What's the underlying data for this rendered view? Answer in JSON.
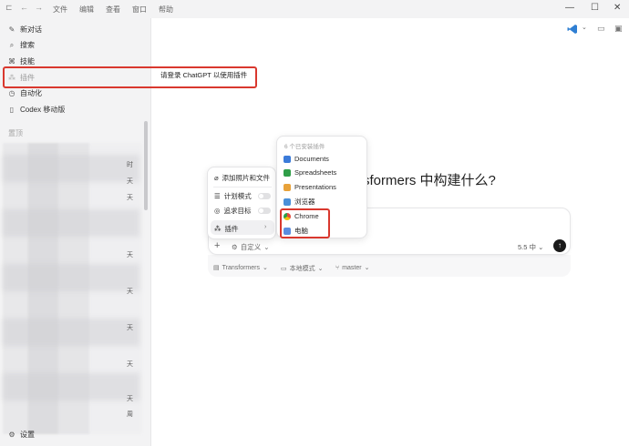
{
  "menubar": {
    "items": [
      "文件",
      "编辑",
      "查看",
      "窗口",
      "帮助"
    ]
  },
  "window_controls": {
    "minimize": "—",
    "maximize": "☐",
    "close": "✕"
  },
  "sidebar": {
    "nav": [
      {
        "label": "新对话",
        "icon": "edit-icon"
      },
      {
        "label": "搜索",
        "icon": "search-icon"
      },
      {
        "label": "技能",
        "icon": "skills-icon"
      },
      {
        "label": "插件",
        "icon": "plugins-icon"
      },
      {
        "label": "自动化",
        "icon": "clock-icon"
      },
      {
        "label": "Codex 移动版",
        "icon": "mobile-icon"
      }
    ],
    "section_pinned": "置顶",
    "thread_times": [
      "时",
      "天",
      "天",
      "天",
      "天",
      "天",
      "天",
      "天",
      "周"
    ],
    "settings_label": "设置"
  },
  "tooltip": {
    "text": "请登录 ChatGPT 以使用插件"
  },
  "main": {
    "headline": "sformers 中构建什么?",
    "composer": {
      "custom_label": "自定义",
      "model_label": "5.5 中",
      "chips": [
        "Transformers",
        "本地模式",
        "master"
      ]
    }
  },
  "attach_menu": {
    "items": [
      "添加照片和文件",
      "计划模式",
      "追求目标",
      "插件"
    ]
  },
  "plugins_menu": {
    "header": "6 个已安装插件",
    "items": [
      "Documents",
      "Spreadsheets",
      "Presentations",
      "浏览器",
      "Chrome",
      "电脑"
    ],
    "colors": [
      "#3b7bd9",
      "#2f9e48",
      "#e8a23a",
      "#4a90d9",
      "#e24a3b",
      "#5b8de0"
    ]
  },
  "colors": {
    "highlight_border": "#d9382e",
    "vscode_blue": "#2f7fd3"
  }
}
